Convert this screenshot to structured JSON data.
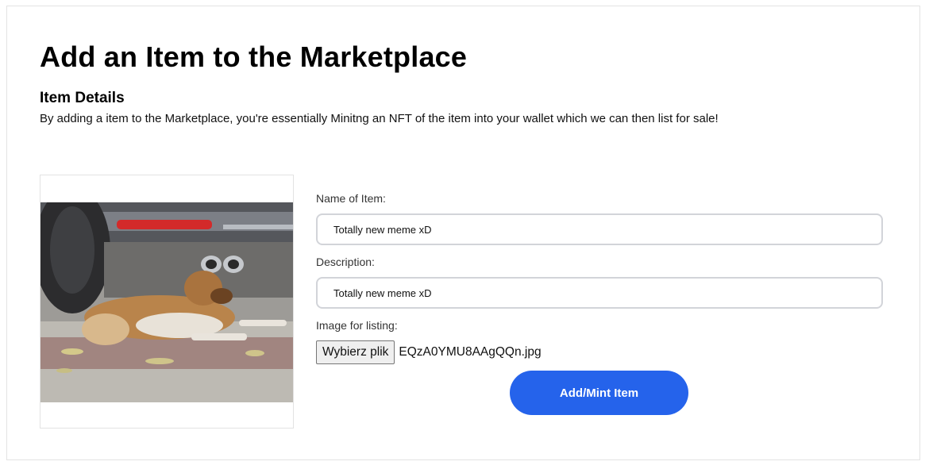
{
  "page": {
    "title": "Add an Item to the Marketplace"
  },
  "details": {
    "title": "Item Details",
    "description": "By adding a item to the Marketplace, you're essentially Minitng an NFT of the item into your wallet which we can then list for sale!"
  },
  "preview": {
    "image": "dog-under-car-photo"
  },
  "form": {
    "name_label": "Name of Item:",
    "name_value": "Totally new meme xD",
    "description_label": "Description:",
    "description_value": "Totally new meme xD",
    "image_label": "Image for listing:",
    "file_button_label": "Wybierz plik",
    "file_name": "EQzA0YMU8AAgQQn.jpg",
    "submit_label": "Add/Mint Item"
  },
  "colors": {
    "accent": "#2563eb",
    "input_border": "#d2d4d9"
  }
}
